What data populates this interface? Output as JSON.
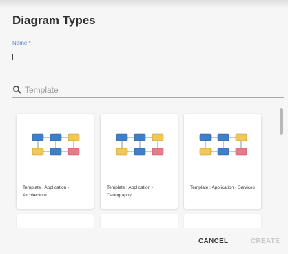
{
  "dialog": {
    "title": "Diagram Types",
    "name_field": {
      "label": "Name",
      "required_mark": "*",
      "value": ""
    },
    "search": {
      "placeholder": "Template"
    },
    "templates": [
      {
        "label": "Template : Application - Architecture"
      },
      {
        "label": "Template : Application - Cartography"
      },
      {
        "label": "Template : Application - Services"
      }
    ],
    "actions": {
      "cancel": "CANCEL",
      "create": "CREATE"
    }
  },
  "colors": {
    "accent": "#4a78c4",
    "node_blue": "#3f7fc8",
    "node_yellow": "#f1c75a",
    "node_pink": "#e87a8a"
  }
}
